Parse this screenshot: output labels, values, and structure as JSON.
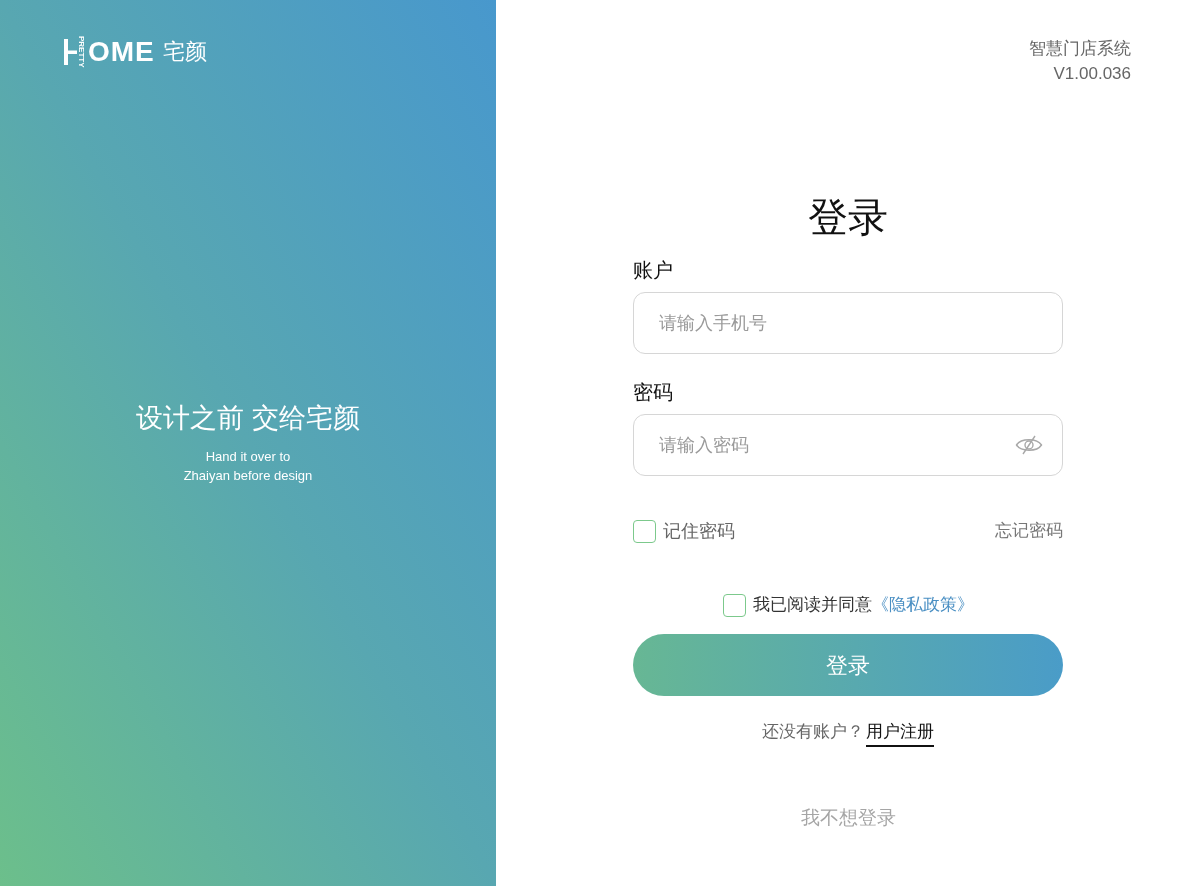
{
  "brand": {
    "logo_letters": "OME",
    "logo_vertical_text": "PRETTY",
    "logo_name": "宅颜",
    "slogan": "设计之前 交给宅颜",
    "slogan_en_lines": [
      "Hand it over to",
      "Zhaiyan before design"
    ]
  },
  "header": {
    "system_name": "智慧门店系统",
    "version": "V1.00.036"
  },
  "login_form": {
    "title": "登录",
    "fields": [
      {
        "kind": "text",
        "label": "账户",
        "placeholder": "请输入手机号"
      },
      {
        "kind": "password",
        "label": "密码",
        "placeholder": "请输入密码",
        "password_visible": false
      }
    ],
    "remember": {
      "label": "记住密码",
      "checked": false
    },
    "forgot_link": "忘记密码",
    "agreement": {
      "text": "我已阅读并同意",
      "link": "《隐私政策》",
      "checked": false
    },
    "submit_button": "登录",
    "register_prompt": "还没有账户？",
    "register_link": "用户注册",
    "skip_link": "我不想登录"
  }
}
